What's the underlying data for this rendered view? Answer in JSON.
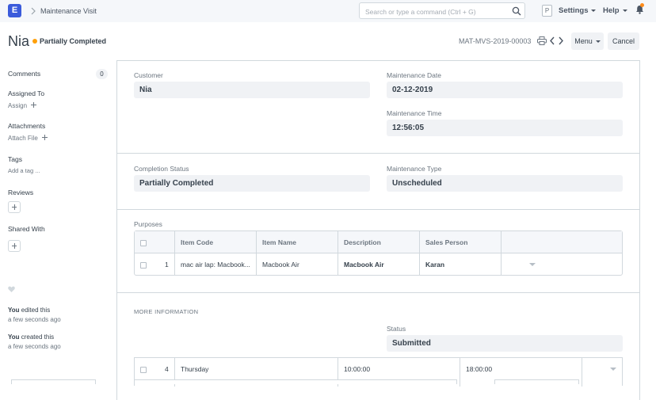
{
  "navbar": {
    "logo_letter": "E",
    "breadcrumb": "Maintenance Visit",
    "search_placeholder": "Search or type a command (Ctrl + G)",
    "avatar_letter": "P",
    "settings_label": "Settings",
    "help_label": "Help"
  },
  "page": {
    "title": "Nia",
    "status": "Partially Completed",
    "status_color": "#ffa00a",
    "doc_name": "MAT-MVS-2019-00003",
    "menu_label": "Menu",
    "cancel_label": "Cancel"
  },
  "sidebar": {
    "comments_label": "Comments",
    "comments_count": "0",
    "assigned_to_label": "Assigned To",
    "assign_label": "Assign",
    "attachments_label": "Attachments",
    "attach_file_label": "Attach File",
    "tags_label": "Tags",
    "add_tag_label": "Add a tag ...",
    "reviews_label": "Reviews",
    "shared_with_label": "Shared With",
    "activity": [
      {
        "user": "You",
        "action": " edited this",
        "time": "a few seconds ago"
      },
      {
        "user": "You",
        "action": " created this",
        "time": "a few seconds ago"
      }
    ]
  },
  "form": {
    "customer_label": "Customer",
    "customer_value": "Nia",
    "maintenance_date_label": "Maintenance Date",
    "maintenance_date_value": "02-12-2019",
    "maintenance_time_label": "Maintenance Time",
    "maintenance_time_value": "12:56:05",
    "completion_status_label": "Completion Status",
    "completion_status_value": "Partially Completed",
    "maintenance_type_label": "Maintenance Type",
    "maintenance_type_value": "Unscheduled",
    "purposes_label": "Purposes",
    "more_info_label": "MORE INFORMATION",
    "status_label": "Status",
    "status_value": "Submitted"
  },
  "purposes_table": {
    "columns": [
      "Item Code",
      "Item Name",
      "Description",
      "Sales Person"
    ],
    "rows": [
      {
        "idx": "1",
        "item_code": "mac air lap: Macbook...",
        "item_name": "Macbook Air",
        "description": "Macbook Air",
        "sales_person": "Karan"
      }
    ]
  },
  "schedule_row": {
    "idx": "4",
    "day": "Thursday",
    "from_time": "10:00:00",
    "to_time": "18:00:00"
  }
}
